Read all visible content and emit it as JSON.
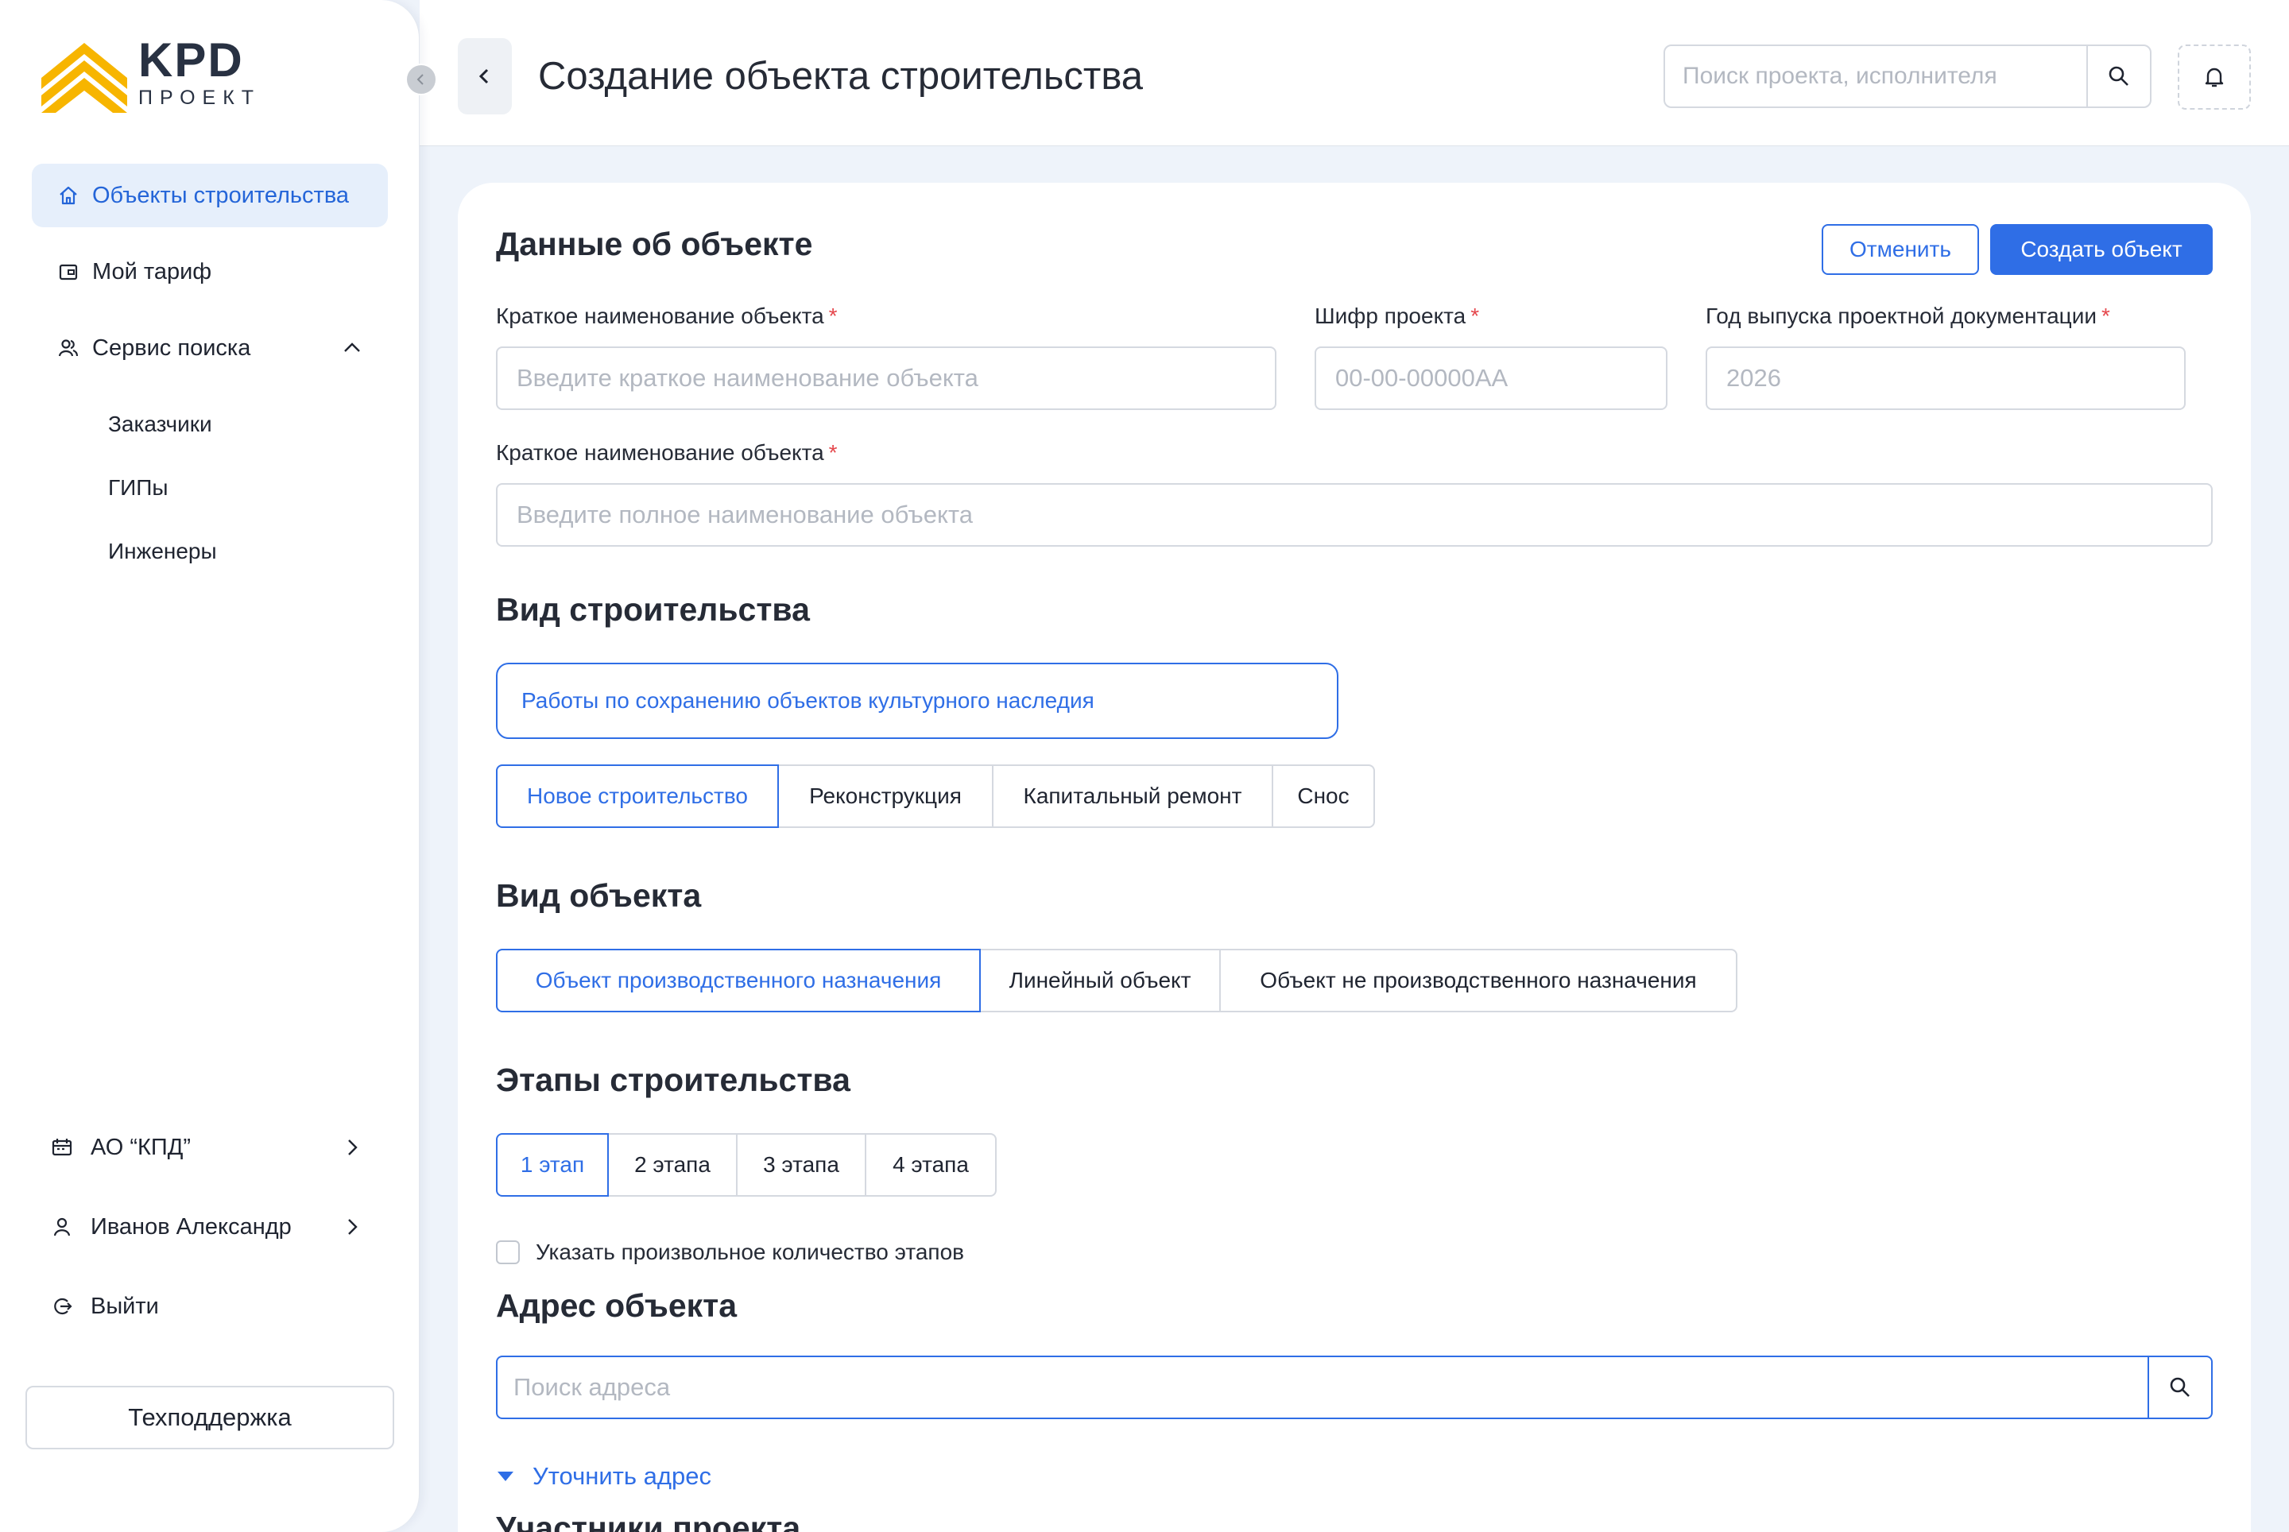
{
  "brand": {
    "title": "KPD",
    "subtitle": "ПРОЕКТ",
    "accent": "#f7b500"
  },
  "sidebar": {
    "items": [
      {
        "label": "Объекты строительства",
        "icon": "home-icon",
        "active": true
      },
      {
        "label": "Мой тариф",
        "icon": "wallet-icon"
      },
      {
        "label": "Сервис поиска",
        "icon": "users-icon",
        "expanded": true
      }
    ],
    "sub_items": [
      {
        "label": "Заказчики"
      },
      {
        "label": "ГИПы"
      },
      {
        "label": "Инженеры"
      }
    ],
    "bottom": [
      {
        "label": "АО “КПД”",
        "icon": "company-icon"
      },
      {
        "label": "Иванов Александр",
        "icon": "user-icon"
      },
      {
        "label": "Выйти",
        "icon": "logout-icon"
      }
    ],
    "support_label": "Техподдержка"
  },
  "header": {
    "title": "Создание объекта строительства",
    "search_placeholder": "Поиск проекта, исполнителя"
  },
  "form": {
    "section_title": "Данные об объекте",
    "cancel_label": "Отменить",
    "create_label": "Создать объект",
    "short_name": {
      "label": "Краткое наименование объекта",
      "placeholder": "Введите краткое наименование объекта"
    },
    "cipher": {
      "label": "Шифр проекта",
      "placeholder": "00-00-00000АА"
    },
    "year": {
      "label": "Год выпуска проектной документации",
      "placeholder": "2026"
    },
    "full_name": {
      "label": "Краткое наименование объекта",
      "placeholder": "Введите полное наименование объекта"
    },
    "required_mark": "*"
  },
  "construction_type": {
    "title": "Вид строительства",
    "selected_work": "Работы по сохранению объектов культурного наследия",
    "options": [
      "Новое строительство",
      "Реконструкция",
      "Капитальный ремонт",
      "Снос"
    ],
    "active_index": 0
  },
  "object_type": {
    "title": "Вид объекта",
    "options": [
      "Объект производственного назначения",
      "Линейный объект",
      "Объект не производственного назначения"
    ],
    "active_index": 0
  },
  "stages": {
    "title": "Этапы строительства",
    "options": [
      "1 этап",
      "2 этапа",
      "3 этапа",
      "4 этапа"
    ],
    "active_index": 0,
    "custom_label": "Указать произвольное количество этапов",
    "custom_checked": false
  },
  "address": {
    "title": "Адрес объекта",
    "placeholder": "Поиск адреса",
    "refine_label": "Уточнить адрес"
  },
  "participants": {
    "title": "Участники проекта"
  },
  "colors": {
    "primary": "#2f6ee6",
    "active_nav_bg": "#e6effb",
    "required": "#e5484d",
    "background": "#eef3fa"
  }
}
